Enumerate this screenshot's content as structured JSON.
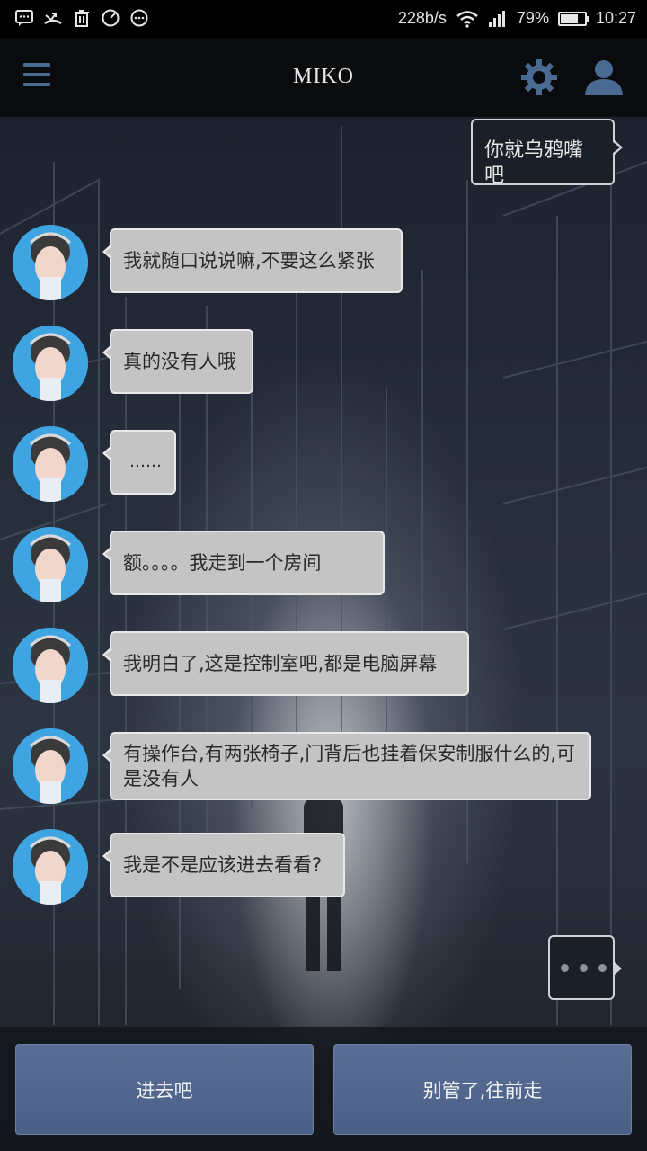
{
  "status_bar": {
    "net_speed": "228b/s",
    "battery_percent_text": "79%",
    "battery_level": 0.79,
    "time": "10:27",
    "left_icons": [
      "message-icon",
      "missed-call-icon",
      "trash-icon",
      "speed-icon",
      "more-icon"
    ]
  },
  "header": {
    "title": "MIKO"
  },
  "chat": {
    "outgoing": [
      {
        "text": "你就乌鸦嘴吧"
      }
    ],
    "incoming": [
      {
        "text": "我就随口说说嘛,不要这么紧张"
      },
      {
        "text": "真的没有人哦"
      },
      {
        "text": "……"
      },
      {
        "text": "额。。。。我走到一个房间"
      },
      {
        "text": "我明白了,这是控制室吧,都是电脑屏幕"
      },
      {
        "text": "有操作台,有两张椅子,门背后也挂着保安制服什么的,可是没有人"
      },
      {
        "text": "我是不是应该进去看看?"
      }
    ],
    "typing_indicator": "..."
  },
  "choices": [
    {
      "label": "进去吧"
    },
    {
      "label": "别管了,往前走"
    }
  ],
  "colors": {
    "accent": "#4a6a94",
    "incoming_bubble": "#c4c4c4",
    "choice_button": "#52678e"
  }
}
